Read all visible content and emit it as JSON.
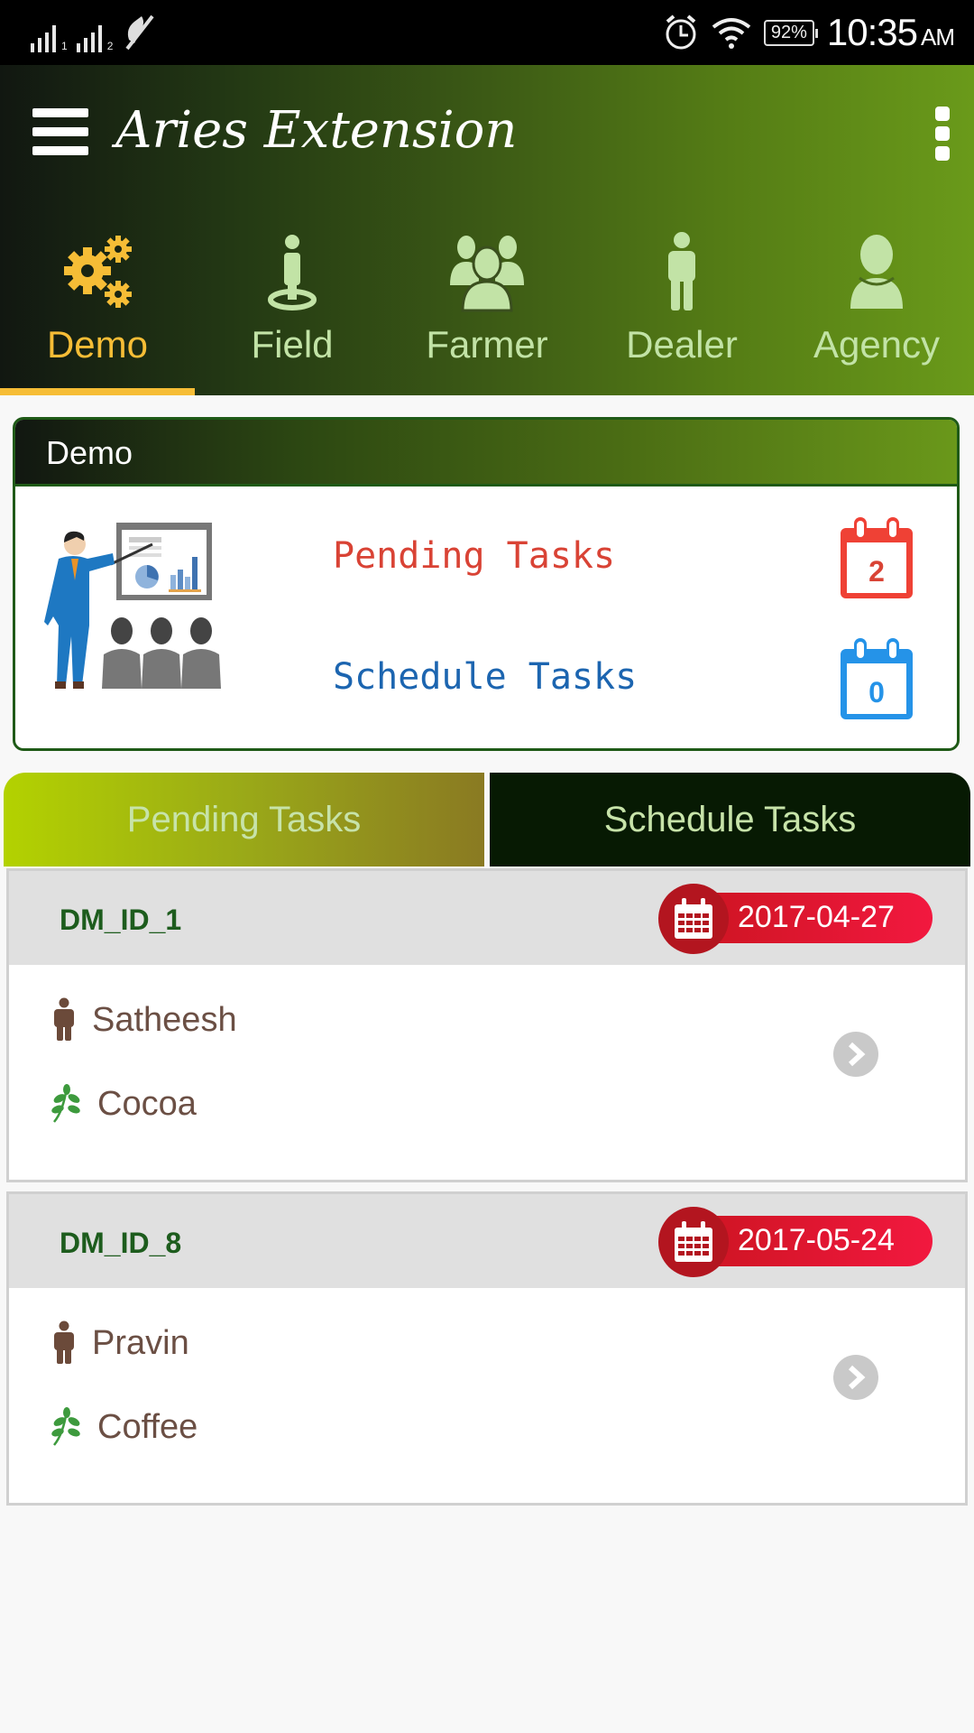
{
  "status_bar": {
    "sim1_label": "1",
    "sim2_label": "2",
    "battery": "92%",
    "time": "10:35",
    "ampm": "AM"
  },
  "app_bar": {
    "title": "Aries Extension"
  },
  "nav_tabs": [
    {
      "label": "Demo",
      "icon": "gears-icon",
      "active": true
    },
    {
      "label": "Field",
      "icon": "person-location-icon",
      "active": false
    },
    {
      "label": "Farmer",
      "icon": "group-icon",
      "active": false
    },
    {
      "label": "Dealer",
      "icon": "man-icon",
      "active": false
    },
    {
      "label": "Agency",
      "icon": "user-icon",
      "active": false
    }
  ],
  "summary_card": {
    "title": "Demo",
    "pending_label": "Pending Tasks",
    "pending_count": "2",
    "schedule_label": "Schedule Tasks",
    "schedule_count": "0"
  },
  "segment_tabs": {
    "pending": "Pending Tasks",
    "schedule": "Schedule Tasks"
  },
  "tasks": [
    {
      "id": "DM_ID_1",
      "date": "2017-04-27",
      "farmer": "Satheesh",
      "crop": "Cocoa"
    },
    {
      "id": "DM_ID_8",
      "date": "2017-05-24",
      "farmer": "Pravin",
      "crop": "Coffee"
    }
  ],
  "colors": {
    "accent_active": "#f6bd36",
    "tab_inactive": "#c2e3a6",
    "pending_red": "#d94335",
    "schedule_blue": "#1c65b0",
    "date_badge": "#e8172f",
    "task_id_green": "#1d5c1d"
  }
}
